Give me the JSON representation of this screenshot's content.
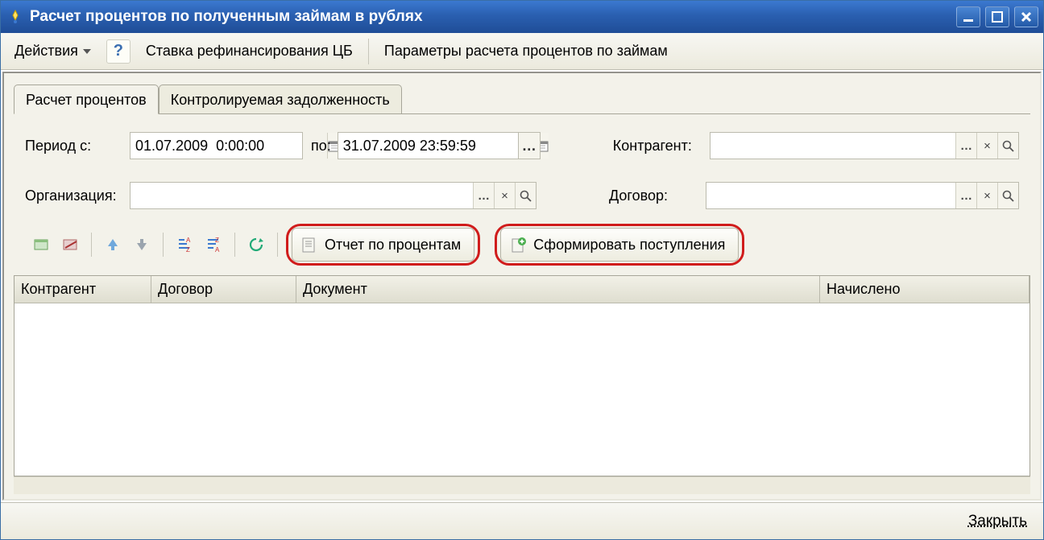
{
  "title": "Расчет процентов по полученным займам в рублях",
  "toolbar": {
    "actions": "Действия",
    "refin_rate": "Ставка рефинансирования ЦБ",
    "calc_params": "Параметры расчета процентов по займам"
  },
  "tabs": {
    "calc": "Расчет процентов",
    "controlled": "Контролируемая задолженность"
  },
  "form": {
    "period_from_label": "Период с:",
    "period_from_value": "01.07.2009  0:00:00",
    "period_to_label": "по:",
    "period_to_value": "31.07.2009 23:59:59",
    "org_label": "Организация:",
    "org_value": "",
    "counterparty_label": "Контрагент:",
    "counterparty_value": "",
    "contract_label": "Договор:",
    "contract_value": ""
  },
  "actions": {
    "report": "Отчет по процентам",
    "generate": "Сформировать поступления"
  },
  "grid": {
    "col_counterparty": "Контрагент",
    "col_contract": "Договор",
    "col_document": "Документ",
    "col_accrued": "Начислено"
  },
  "footer": {
    "close": "Закрыть"
  }
}
